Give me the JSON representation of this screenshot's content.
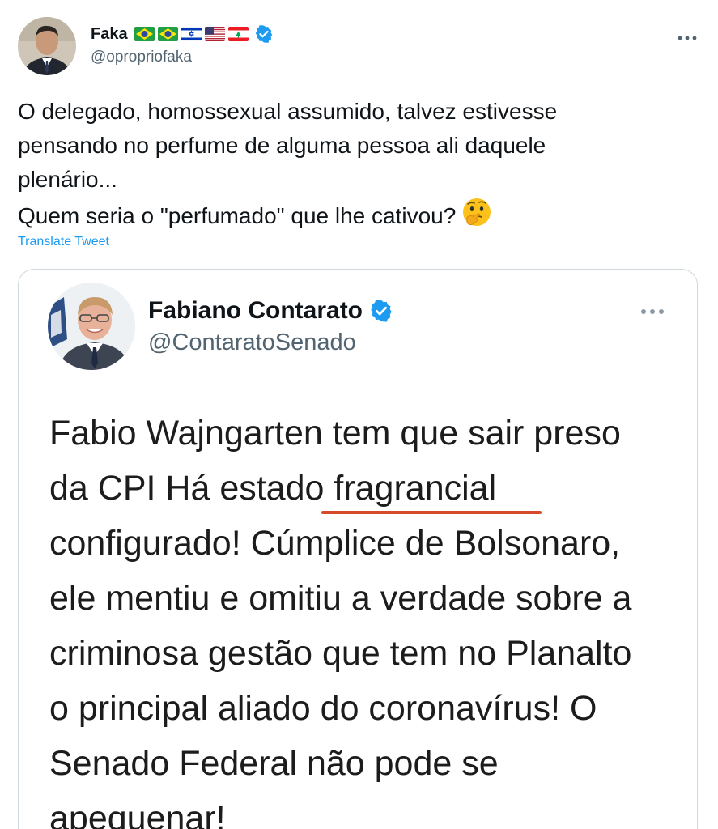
{
  "tweet": {
    "author": {
      "display_name": "Faka",
      "handle": "@opropriofaka",
      "avatar_icon": "profile-photo",
      "verified_icon": "verified-badge-icon",
      "flags": [
        "brazil-flag-icon",
        "brazil-flag-icon",
        "israel-flag-icon",
        "usa-flag-icon",
        "lebanon-flag-icon"
      ]
    },
    "more_icon": "more-options-icon",
    "text_lines": [
      "O delegado, homossexual assumido, talvez estivesse",
      "pensando no perfume de alguma pessoa ali daquele",
      "plenário...",
      "Quem seria o \"perfumado\" que lhe cativou?"
    ],
    "emoji": "thinking-face-icon",
    "translate_label": "Translate Tweet"
  },
  "quoted_tweet": {
    "author": {
      "display_name": "Fabiano Contarato",
      "handle": "@ContaratoSenado",
      "avatar_icon": "profile-photo",
      "verified_icon": "verified-badge-icon"
    },
    "more_icon": "more-options-icon",
    "text_lines": [
      "Fabio Wajngarten tem que sair preso",
      "da CPI Há estado fragrancial",
      "configurado! Cúmplice de Bolsonaro,",
      "ele mentiu e omitiu a verdade sobre a",
      "criminosa gestão que tem no Planalto",
      "o principal aliado do coronavírus! O",
      "Senado Federal não pode se",
      "apequenar!"
    ],
    "highlight_color": "#d64a2b"
  },
  "colors": {
    "link_blue": "#1d9bf0",
    "secondary_text": "#536471",
    "card_border": "#cfd9de",
    "verified_blue": "#1d9bf0"
  }
}
